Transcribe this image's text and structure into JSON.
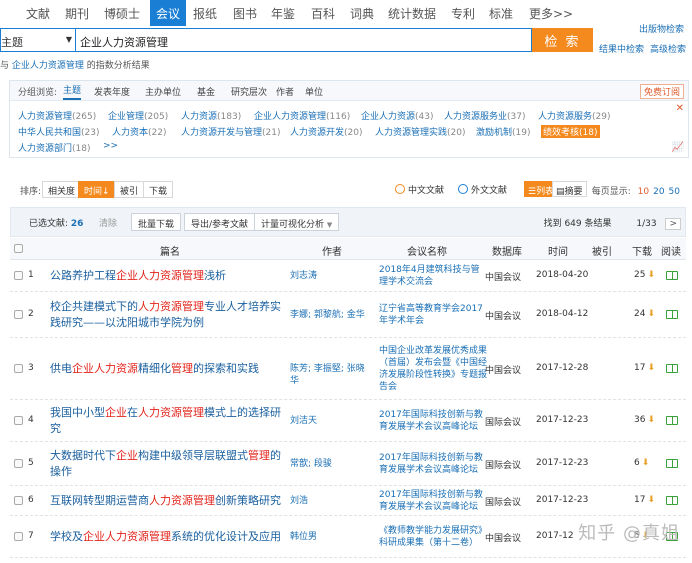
{
  "nav": {
    "items": [
      "文献",
      "期刊",
      "博硕士",
      "会议",
      "报纸",
      "图书",
      "年鉴",
      "百科",
      "词典",
      "统计数据",
      "专利",
      "标准",
      "更多>>"
    ],
    "active_index": 3,
    "right_link": "出版物检索"
  },
  "search": {
    "field": "主题",
    "value": "企业人力资源管理",
    "button": "检 索",
    "link_result": "结果中检索",
    "link_advanced": "高级检索"
  },
  "hint": {
    "prefix": "与",
    "keyword": "企业人力资源管理",
    "suffix": "的指数分析结果"
  },
  "grouping": {
    "label": "分组浏览:",
    "tabs": [
      "主题",
      "发表年度",
      "主办单位",
      "基金",
      "研究层次",
      "作者",
      "单位"
    ],
    "active_index": 0,
    "free_order": "免费订阅",
    "facets": [
      {
        "name": "人力资源管理",
        "count": "(265)"
      },
      {
        "name": "企业管理",
        "count": "(205)"
      },
      {
        "name": "人力资源",
        "count": "(183)"
      },
      {
        "name": "企业人力资源管理",
        "count": "(116)"
      },
      {
        "name": "企业人力资源",
        "count": "(43)"
      },
      {
        "name": "人力资源服务业",
        "count": "(37)"
      },
      {
        "name": "人力资源服务",
        "count": "(29)"
      },
      {
        "name": "中华人民共和国",
        "count": "(23)"
      },
      {
        "name": "人力资本",
        "count": "(22)"
      },
      {
        "name": "人力资源开发与管理",
        "count": "(21)"
      },
      {
        "name": "人力资源开发",
        "count": "(20)"
      },
      {
        "name": "人力资源管理实践",
        "count": "(20)"
      },
      {
        "name": "激励机制",
        "count": "(19)"
      },
      {
        "name": "绩效考核",
        "count": "(18)"
      },
      {
        "name": "人力资源部门",
        "count": "(18)"
      }
    ],
    "more": ">>"
  },
  "sort": {
    "label": "排序:",
    "options": [
      "相关度",
      "时间↓",
      "被引",
      "下载"
    ],
    "active_index": 1,
    "lang_cn": "中文文献",
    "lang_foreign": "外文文献",
    "view_list": "列表",
    "view_abstract": "摘要",
    "per_page_label": "每页显示:",
    "per_page": [
      "10",
      "20",
      "50"
    ],
    "per_page_active": 0
  },
  "toolbar": {
    "selected_label": "已选文献:",
    "selected_count": "26",
    "clear": "清除",
    "batch": "批量下载",
    "export": "导出/参考文献",
    "visualize": "计量可视化分析",
    "found": "找到 649 条结果",
    "page": "1/33",
    "next": ">"
  },
  "table": {
    "headers": [
      "篇名",
      "作者",
      "会议名称",
      "数据库",
      "时间",
      "被引",
      "下载",
      "阅读"
    ],
    "rows": [
      {
        "idx": "1",
        "title": [
          [
            "公路养护工程",
            false
          ],
          [
            "企业人力资源管理",
            true
          ],
          [
            "浅析",
            false
          ]
        ],
        "author": "刘志涛",
        "conf": "2018年4月建筑科技与管理学术交流会",
        "db": "中国会议",
        "date": "2018-04-20",
        "dl": "25"
      },
      {
        "idx": "2",
        "title": [
          [
            "校企共建模式下的",
            false
          ],
          [
            "人力资源管理",
            true
          ],
          [
            "专业人才培养实践研究——以沈阳城市学院为例",
            false
          ]
        ],
        "author": "李娜; 郭黎航; 金华",
        "conf": "辽宁省高等教育学会2017年学术年会",
        "db": "中国会议",
        "date": "2018-04-12",
        "dl": "24"
      },
      {
        "idx": "3",
        "title": [
          [
            "供电",
            false
          ],
          [
            "企业人力资源",
            true
          ],
          [
            "精细化",
            false
          ],
          [
            "管理",
            true
          ],
          [
            "的探索和实践",
            false
          ]
        ],
        "author": "陈芳; 李振堅; 张晓华",
        "conf": "中国企业改革发展优秀成果（首届）发布会暨《中国经济发展阶段性转换》专题报告会",
        "db": "中国会议",
        "date": "2017-12-28",
        "dl": "17"
      },
      {
        "idx": "4",
        "title": [
          [
            "我国中小型",
            false
          ],
          [
            "企业",
            true
          ],
          [
            "在",
            false
          ],
          [
            "人力资源管理",
            true
          ],
          [
            "模式上的选择研究",
            false
          ]
        ],
        "author": "刘洁天",
        "conf": "2017年国际科技创新与教育发展学术会议高峰论坛",
        "db": "国际会议",
        "date": "2017-12-23",
        "dl": "36"
      },
      {
        "idx": "5",
        "title": [
          [
            "大数据时代下",
            false
          ],
          [
            "企业",
            true
          ],
          [
            "构建中级领导层联盟式",
            false
          ],
          [
            "管理",
            true
          ],
          [
            "的操作",
            false
          ]
        ],
        "author": "常歆; 段骏",
        "conf": "2017年国际科技创新与教育发展学术会议高峰论坛",
        "db": "国际会议",
        "date": "2017-12-23",
        "dl": "6"
      },
      {
        "idx": "6",
        "title": [
          [
            "互联网转型期运营商",
            false
          ],
          [
            "人力资源管理",
            true
          ],
          [
            "创新策略研究",
            false
          ]
        ],
        "author": "刘浩",
        "conf": "2017年国际科技创新与教育发展学术会议高峰论坛",
        "db": "国际会议",
        "date": "2017-12-23",
        "dl": "17"
      },
      {
        "idx": "7",
        "title": [
          [
            "学校及",
            false
          ],
          [
            "企业人力资源管理",
            true
          ],
          [
            "系统的优化设计及应用",
            false
          ]
        ],
        "author": "韩位男",
        "conf": "《教师教学能力发展研究》科研成果集（第十二卷）",
        "db": "中国会议",
        "date": "2017-12",
        "dl": "5"
      }
    ]
  },
  "watermark": "知乎 @真姐"
}
